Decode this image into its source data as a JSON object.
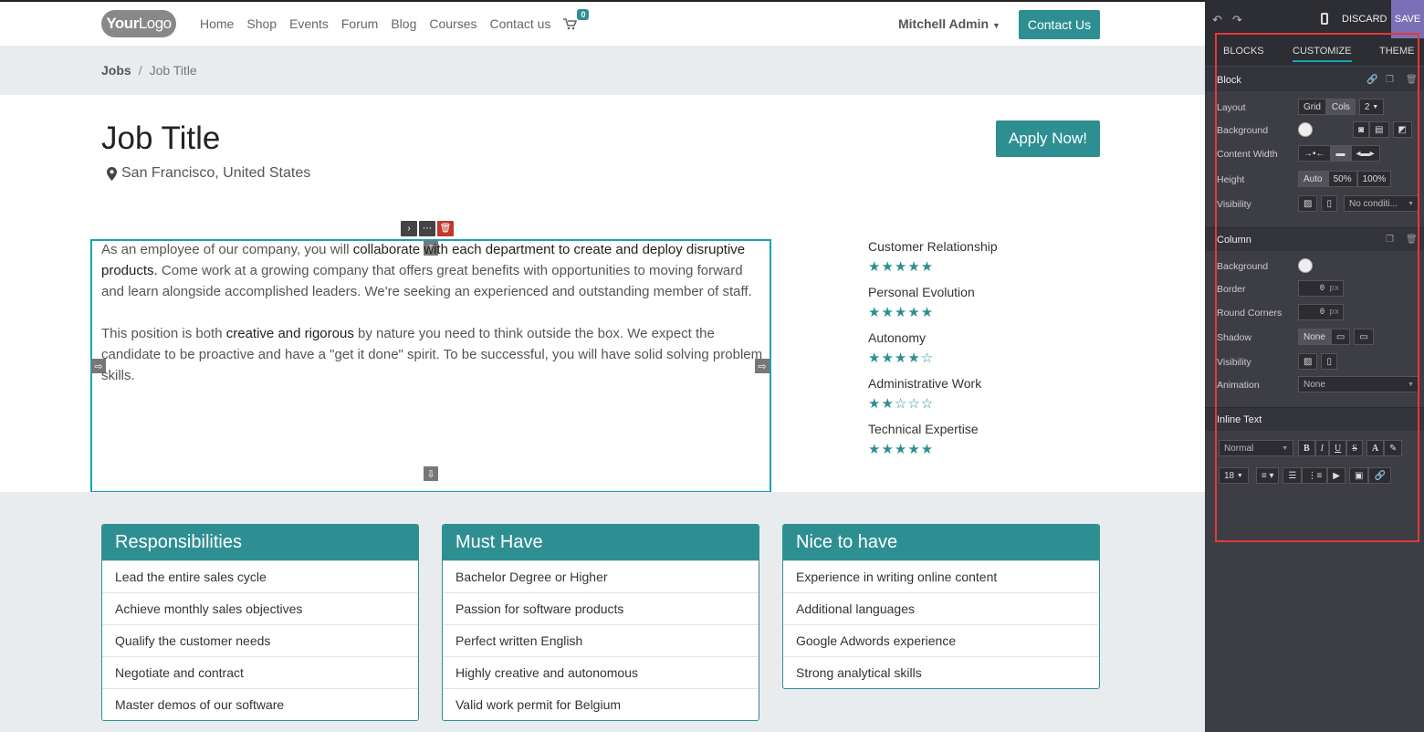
{
  "nav": {
    "logo_your": "Your",
    "logo_logo": "Logo",
    "menu": [
      "Home",
      "Shop",
      "Events",
      "Forum",
      "Blog",
      "Courses",
      "Contact us"
    ],
    "cart_count": "0",
    "user": "Mitchell Admin",
    "contact_btn": "Contact Us"
  },
  "breadcrumb": {
    "parent": "Jobs",
    "separator": "/",
    "current": "Job Title"
  },
  "job": {
    "title": "Job Title",
    "location": "San Francisco, United States",
    "apply": "Apply Now!",
    "p1_a": "As an employee of our company, you will ",
    "p1_b": "collaborate with each department to create and deploy disruptive products.",
    "p1_c": " Come work at a growing company that offers great benefits with opportunities to moving forward and learn alongside accomplished leaders. We're seeking an experienced and outstanding member of staff.",
    "p2_a": "This position is both ",
    "p2_b": "creative and rigorous",
    "p2_c": " by nature you need to think outside the box. We expect the candidate to be proactive and have a \"get it done\" spirit. To be successful, you will have solid solving problem skills."
  },
  "skills": [
    {
      "name": "Customer Relationship",
      "stars": 5
    },
    {
      "name": "Personal Evolution",
      "stars": 5
    },
    {
      "name": "Autonomy",
      "stars": 4
    },
    {
      "name": "Administrative Work",
      "stars": 2
    },
    {
      "name": "Technical Expertise",
      "stars": 5
    }
  ],
  "cards": [
    {
      "title": "Responsibilities",
      "items": [
        "Lead the entire sales cycle",
        "Achieve monthly sales objectives",
        "Qualify the customer needs",
        "Negotiate and contract",
        "Master demos of our software"
      ]
    },
    {
      "title": "Must Have",
      "items": [
        "Bachelor Degree or Higher",
        "Passion for software products",
        "Perfect written English",
        "Highly creative and autonomous",
        "Valid work permit for Belgium"
      ]
    },
    {
      "title": "Nice to have",
      "items": [
        "Experience in writing online content",
        "Additional languages",
        "Google Adwords experience",
        "Strong analytical skills"
      ]
    }
  ],
  "panel": {
    "discard": "DISCARD",
    "save": "SAVE",
    "tabs": [
      "BLOCKS",
      "CUSTOMIZE",
      "THEME"
    ],
    "block": {
      "title": "Block",
      "layout": "Layout",
      "layout_grid": "Grid",
      "layout_cols": "Cols",
      "layout_num": "2",
      "background": "Background",
      "content_width": "Content Width",
      "height": "Height",
      "height_opts": [
        "Auto",
        "50%",
        "100%"
      ],
      "visibility": "Visibility",
      "visibility_value": "No conditi..."
    },
    "column": {
      "title": "Column",
      "background": "Background",
      "border": "Border",
      "border_value": "0",
      "border_unit": "px",
      "round": "Round Corners",
      "round_value": "0",
      "round_unit": "px",
      "shadow": "Shadow",
      "shadow_value": "None",
      "visibility": "Visibility",
      "animation": "Animation",
      "animation_value": "None"
    },
    "inline": {
      "title": "Inline Text",
      "style": "Normal",
      "size": "18",
      "fmt": [
        "B",
        "I",
        "U",
        "S",
        "A"
      ]
    }
  },
  "colors": {
    "accent": "#2e8f92",
    "selection": "#17a2b8",
    "panel_bg": "#3d3d46",
    "save_bg": "#7c6fb8",
    "highlight_box": "#e53935"
  }
}
